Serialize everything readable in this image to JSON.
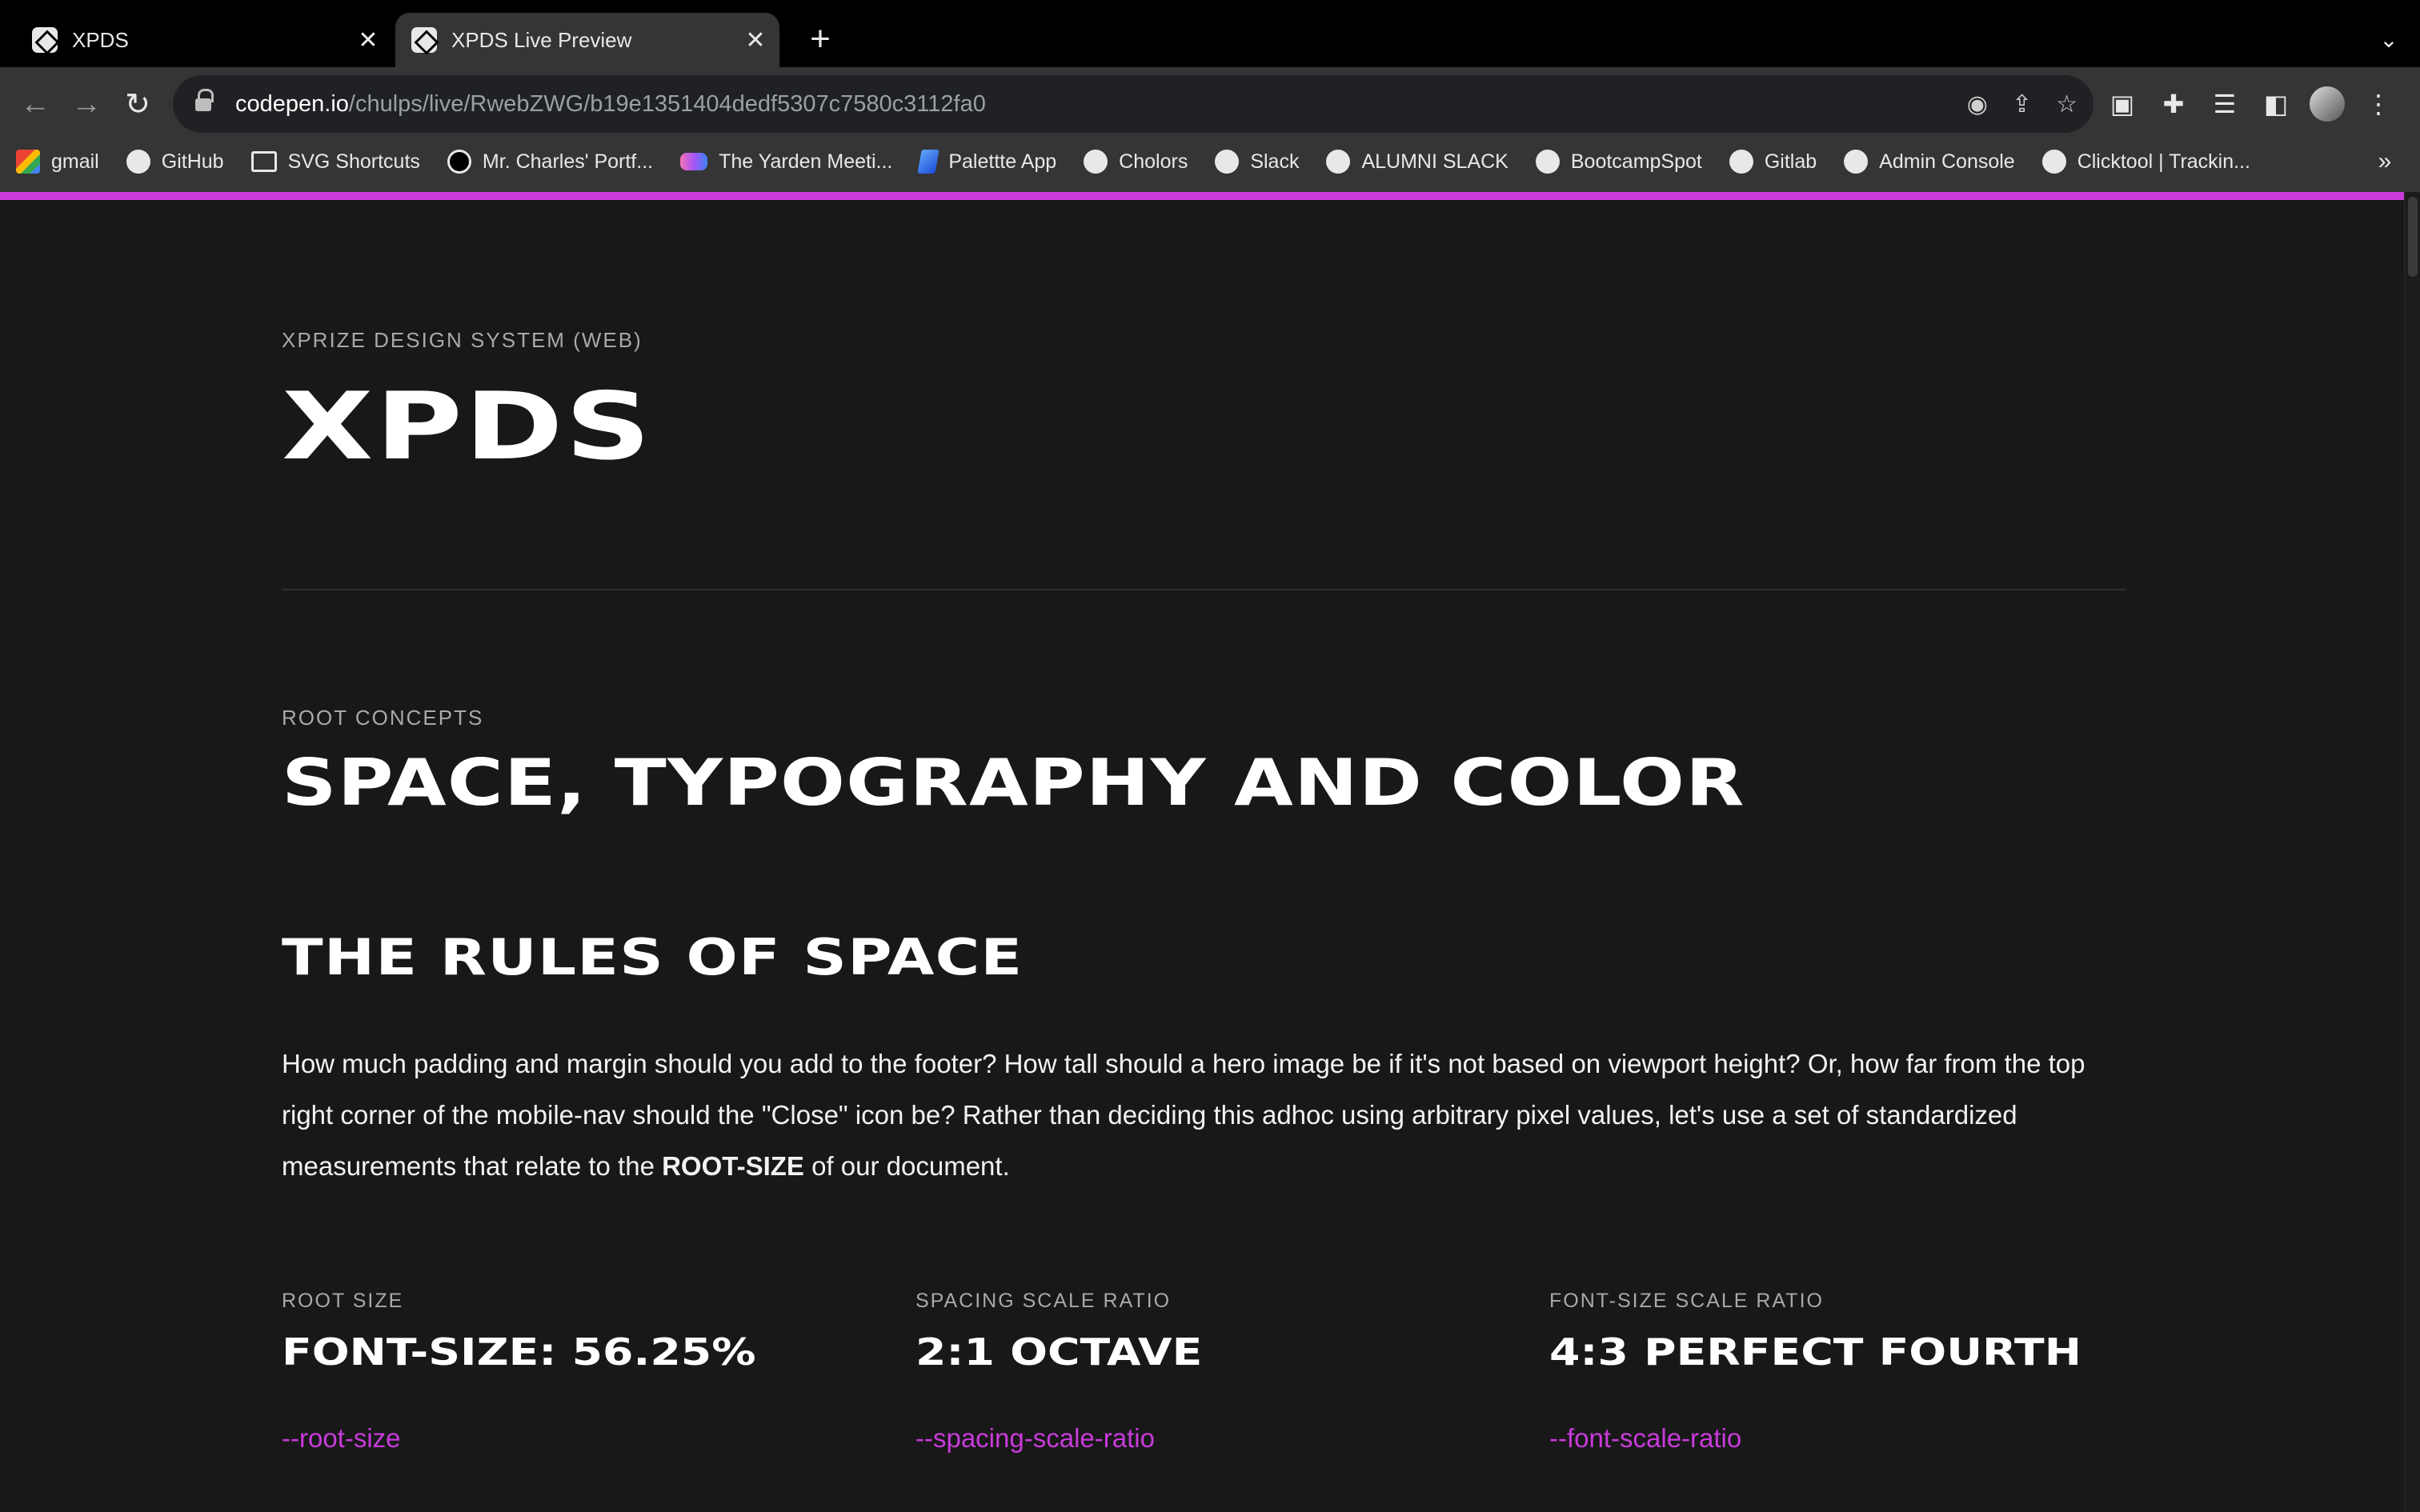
{
  "browser": {
    "tabs": [
      {
        "title": "XPDS",
        "active": false
      },
      {
        "title": "XPDS Live Preview",
        "active": true
      }
    ],
    "url_host": "codepen.io",
    "url_path": "/chulps/live/RwebZWG/b19e1351404dedf5307c7580c3112fa0",
    "bookmarks": [
      {
        "label": "gmail",
        "icon": "gmail-icon"
      },
      {
        "label": "GitHub",
        "icon": "github-icon"
      },
      {
        "label": "SVG Shortcuts",
        "icon": "folder-icon"
      },
      {
        "label": "Mr. Charles' Portf...",
        "icon": "portfolio-icon"
      },
      {
        "label": "The Yarden Meeti...",
        "icon": "gradient-blob-icon"
      },
      {
        "label": "Palettte App",
        "icon": "palette-icon"
      },
      {
        "label": "Cholors",
        "icon": "globe-icon"
      },
      {
        "label": "Slack",
        "icon": "globe-icon"
      },
      {
        "label": "ALUMNI SLACK",
        "icon": "globe-icon"
      },
      {
        "label": "BootcampSpot",
        "icon": "globe-icon"
      },
      {
        "label": "Gitlab",
        "icon": "globe-icon"
      },
      {
        "label": "Admin Console",
        "icon": "globe-icon"
      },
      {
        "label": "Clicktool | Trackin...",
        "icon": "globe-icon"
      }
    ],
    "accent_color": "#c93bdb"
  },
  "page": {
    "hero": {
      "eyebrow": "XPRIZE DESIGN SYSTEM (WEB)",
      "title": "XPDS"
    },
    "root": {
      "eyebrow": "ROOT CONCEPTS",
      "title": "SPACE, TYPOGRAPHY AND COLOR"
    },
    "space": {
      "title": "THE RULES OF SPACE",
      "body_before": "How much padding and margin should you add to the footer? How tall should a hero image be if it's not based on viewport height? Or, how far from the top right corner of the mobile-nav should the \"Close\" icon be? Rather than deciding this adhoc using arbitrary pixel values, let's use a set of standardized measurements that relate to the ",
      "body_bold": "ROOT-SIZE",
      "body_after": " of our document."
    },
    "specs": [
      {
        "label": "ROOT SIZE",
        "value": "FONT-SIZE: 56.25%",
        "var": "--root-size"
      },
      {
        "label": "SPACING SCALE RATIO",
        "value": "2:1 OCTAVE",
        "var": "--spacing-scale-ratio"
      },
      {
        "label": "FONT-SIZE SCALE RATIO",
        "value": "4:3 PERFECT FOURTH",
        "var": "--font-scale-ratio"
      }
    ]
  }
}
